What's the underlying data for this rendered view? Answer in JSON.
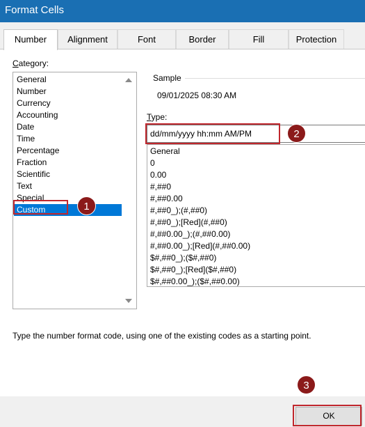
{
  "window": {
    "title": "Format Cells"
  },
  "tabs": [
    "Number",
    "Alignment",
    "Font",
    "Border",
    "Fill",
    "Protection"
  ],
  "category": {
    "label_prefix": "C",
    "label_rest": "ategory:",
    "items": [
      "General",
      "Number",
      "Currency",
      "Accounting",
      "Date",
      "Time",
      "Percentage",
      "Fraction",
      "Scientific",
      "Text",
      "Special",
      "Custom"
    ],
    "selected": "Custom"
  },
  "sample": {
    "label": "Sample",
    "value": "09/01/2025 08:30 AM"
  },
  "type": {
    "label_prefix": "T",
    "label_rest": "ype:",
    "value": "dd/mm/yyyy hh:mm AM/PM"
  },
  "formats": [
    "General",
    "0",
    "0.00",
    "#,##0",
    "#,##0.00",
    "#,##0_);(#,##0)",
    "#,##0_);[Red](#,##0)",
    "#,##0.00_);(#,##0.00)",
    "#,##0.00_);[Red](#,##0.00)",
    "$#,##0_);($#,##0)",
    "$#,##0_);[Red]($#,##0)",
    "$#,##0.00_);($#,##0.00)"
  ],
  "hint": "Type the number format code, using one of the existing codes as a starting point.",
  "buttons": {
    "ok": "OK"
  },
  "annotations": {
    "m1": "1",
    "m2": "2",
    "m3": "3"
  },
  "colors": {
    "titlebar": "#1a6fb3",
    "selection": "#0078d7",
    "annotation": "#c0272d",
    "marker": "#8b1a1a"
  }
}
